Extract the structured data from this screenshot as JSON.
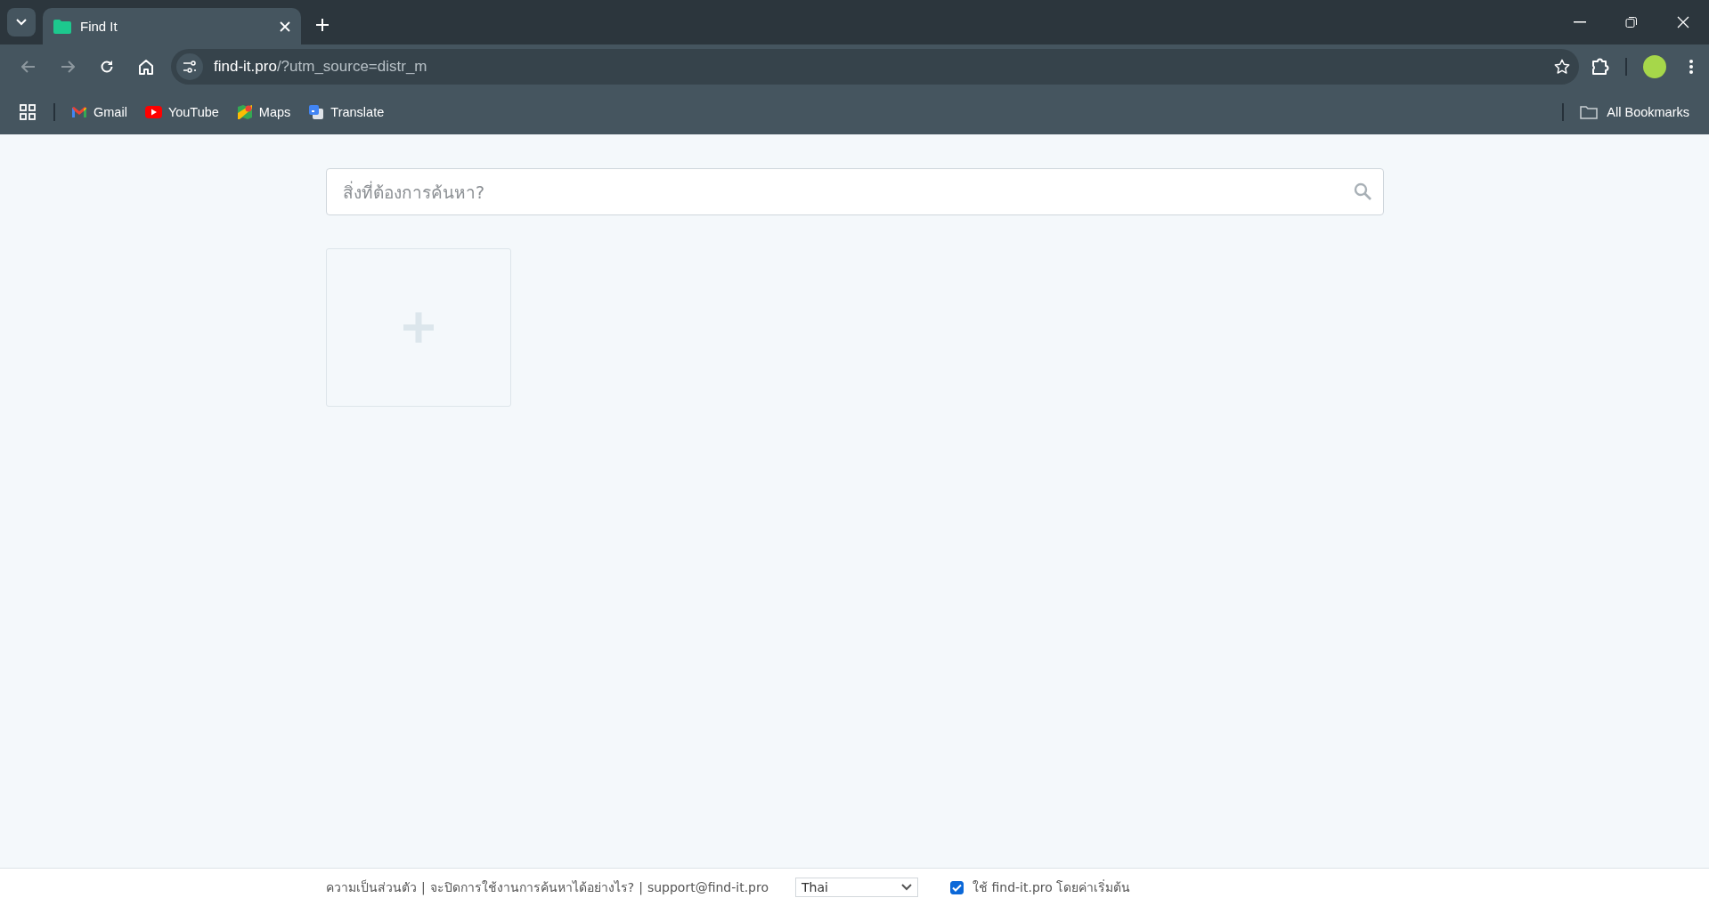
{
  "browser": {
    "tabs": [
      {
        "title": "Find It",
        "selected": true
      }
    ],
    "address": {
      "host": "find-it.pro",
      "path": "/?utm_source=distr_m"
    },
    "bookmarks": [
      {
        "kind": "gmail",
        "label": "Gmail"
      },
      {
        "kind": "youtube",
        "label": "YouTube"
      },
      {
        "kind": "maps",
        "label": "Maps"
      },
      {
        "kind": "translate",
        "label": "Translate"
      }
    ],
    "all_bookmarks": "All Bookmarks"
  },
  "search": {
    "placeholder": "สิ่งที่ต้องการค้นหา?"
  },
  "tiles": [
    {
      "kind": "add"
    }
  ],
  "footer": {
    "links": [
      "ความเป็นส่วนตัว",
      "จะปิดการใช้งานการค้นหาได้อย่างไร?",
      "support@find-it.pro"
    ],
    "separator": "|",
    "language": "Thai",
    "default_option": {
      "label": "ใช้ find-it.pro โดยค่าเริ่มต้น",
      "checked": true
    }
  }
}
